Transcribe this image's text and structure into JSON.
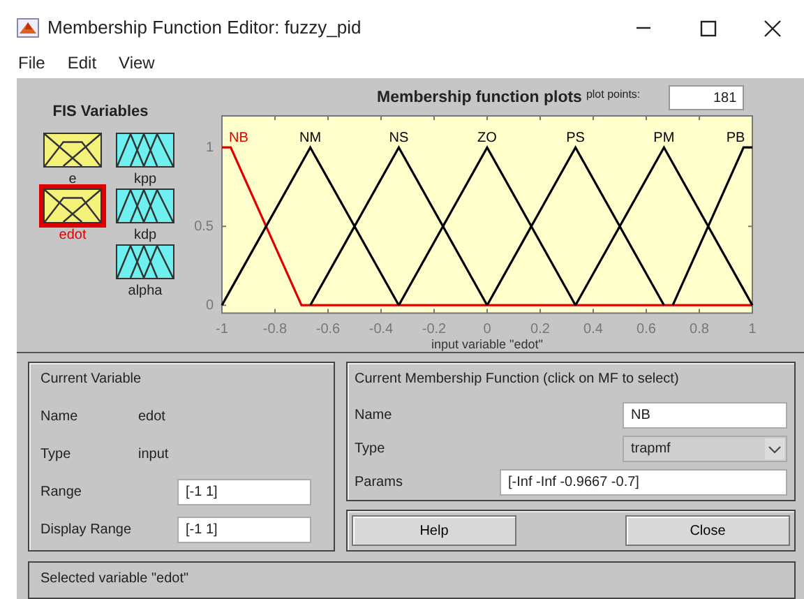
{
  "window": {
    "title": "Membership Function Editor: fuzzy_pid"
  },
  "menu": [
    "File",
    "Edit",
    "View"
  ],
  "fis_variables": {
    "title": "FIS Variables",
    "items": [
      {
        "name": "e",
        "kind": "input",
        "selected": false
      },
      {
        "name": "edot",
        "kind": "input",
        "selected": true
      },
      {
        "name": "kpp",
        "kind": "output",
        "selected": false
      },
      {
        "name": "kdp",
        "kind": "output",
        "selected": false
      },
      {
        "name": "alpha",
        "kind": "output",
        "selected": false
      }
    ]
  },
  "plot": {
    "plot_points_label": "plot points:",
    "plot_points": "181",
    "chart_data": {
      "type": "line",
      "title": "Membership function plots",
      "xlabel": "input variable \"edot\"",
      "x": [
        -1,
        -0.9667,
        -0.7,
        -0.6667,
        -0.3333,
        0,
        0.3333,
        0.6667,
        0.7,
        0.9667,
        1
      ],
      "series": [
        {
          "name": "NB",
          "color": "#e00000",
          "values": [
            1,
            1,
            0,
            0,
            0,
            0,
            0,
            0,
            0,
            0,
            0
          ]
        },
        {
          "name": "NM",
          "color": "#000000",
          "values": [
            0,
            0.1,
            0.9,
            1,
            0,
            null,
            null,
            null,
            null,
            null,
            null
          ]
        },
        {
          "name": "NS",
          "color": "#000000",
          "values": [
            null,
            null,
            null,
            0,
            1,
            0,
            null,
            null,
            null,
            null,
            null
          ]
        },
        {
          "name": "ZO",
          "color": "#000000",
          "values": [
            null,
            null,
            null,
            null,
            0,
            1,
            0,
            null,
            null,
            null,
            null
          ]
        },
        {
          "name": "PS",
          "color": "#000000",
          "values": [
            null,
            null,
            null,
            null,
            null,
            0,
            1,
            0,
            null,
            null,
            null
          ]
        },
        {
          "name": "PM",
          "color": "#000000",
          "values": [
            null,
            null,
            null,
            null,
            null,
            null,
            0,
            1,
            0.9,
            0.1,
            0
          ]
        },
        {
          "name": "PB",
          "color": "#000000",
          "values": [
            null,
            null,
            null,
            null,
            null,
            null,
            null,
            null,
            0,
            1,
            1
          ]
        }
      ],
      "xlim": [
        -1,
        1
      ],
      "ylim": [
        -0.05,
        1.2
      ],
      "xticks": [
        -1,
        -0.8,
        -0.6,
        -0.4,
        -0.2,
        0,
        0.2,
        0.4,
        0.6,
        0.8,
        1
      ],
      "yticks": [
        0,
        0.5,
        1
      ]
    }
  },
  "current_variable": {
    "title": "Current Variable",
    "rows": [
      {
        "label": "Name",
        "value": "edot",
        "kind": "text"
      },
      {
        "label": "Type",
        "value": "input",
        "kind": "text"
      },
      {
        "label": "Range",
        "value": "[-1 1]",
        "kind": "field"
      },
      {
        "label": "Display Range",
        "value": "[-1 1]",
        "kind": "field"
      }
    ]
  },
  "current_mf": {
    "title": "Current Membership Function (click on MF to select)",
    "rows": [
      {
        "label": "Name",
        "value": "NB",
        "kind": "field"
      },
      {
        "label": "Type",
        "value": "trapmf",
        "kind": "dropdown"
      },
      {
        "label": "Params",
        "value": "[-Inf -Inf -0.9667 -0.7]",
        "kind": "wide-field"
      }
    ]
  },
  "buttons": [
    "Help",
    "Close"
  ],
  "status_bar": "Selected variable \"edot\""
}
